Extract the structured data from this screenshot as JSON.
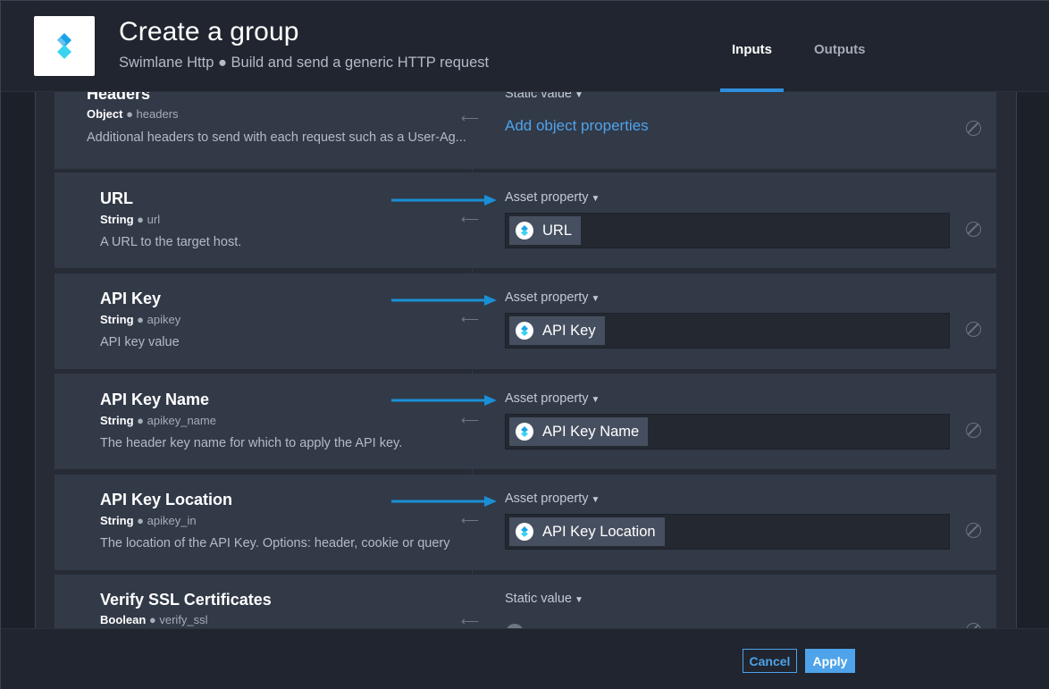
{
  "header": {
    "title": "Create a group",
    "subtitle": "Swimlane Http ● Build and send a generic HTTP request",
    "tabs": [
      {
        "label": "Inputs",
        "active": true
      },
      {
        "label": "Outputs",
        "active": false
      }
    ]
  },
  "rows": [
    {
      "name": "Headers",
      "type": "Object",
      "key": "headers",
      "description": "Additional headers to send with each request such as a User-Ag...",
      "mode": "Static value",
      "link": "Add object properties"
    },
    {
      "name": "URL",
      "type": "String",
      "key": "url",
      "description": "A URL to the target host.",
      "mode": "Asset property",
      "value": "URL"
    },
    {
      "name": "API Key",
      "type": "String",
      "key": "apikey",
      "description": "API key value",
      "mode": "Asset property",
      "value": "API Key"
    },
    {
      "name": "API Key Name",
      "type": "String",
      "key": "apikey_name",
      "description": "The header key name for which to apply the API key.",
      "mode": "Asset property",
      "value": "API Key Name"
    },
    {
      "name": "API Key Location",
      "type": "String",
      "key": "apikey_in",
      "description": "The location of the API Key. Options: header, cookie or query",
      "mode": "Asset property",
      "value": "API Key Location"
    },
    {
      "name": "Verify SSL Certificates",
      "type": "Boolean",
      "key": "verify_ssl",
      "mode": "Static value"
    }
  ],
  "icons": {
    "separator": "⟵",
    "chevron": "⌄",
    "mode_chevron": "chevron-down-icon",
    "clear": "ban-icon",
    "chip": "swimlane-logo-icon"
  },
  "footer": {
    "cancel_label": "Cancel",
    "apply_label": "Apply"
  },
  "colors": {
    "accent": "#4ea3ea",
    "annotation_arrow": "#1a8fd6",
    "logo_blue": "#1aa3e8"
  }
}
